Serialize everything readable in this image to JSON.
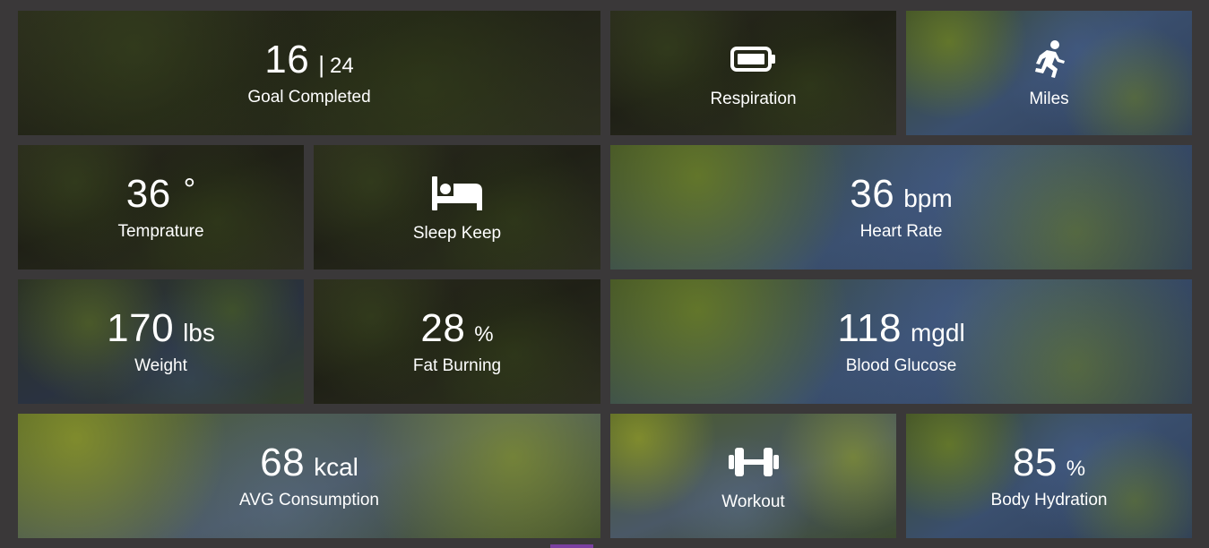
{
  "tiles": {
    "goal": {
      "value": "16",
      "total": "24",
      "separator": "|",
      "label": "Goal Completed"
    },
    "respiration": {
      "icon": "battery-icon",
      "label": "Respiration"
    },
    "miles": {
      "icon": "running-person-icon",
      "label": "Miles"
    },
    "temperature": {
      "value": "36",
      "unit": "°",
      "label": "Temprature"
    },
    "sleep": {
      "icon": "bed-icon",
      "label": "Sleep Keep"
    },
    "heart_rate": {
      "value": "36",
      "unit": "bpm",
      "label": "Heart Rate"
    },
    "weight": {
      "value": "170",
      "unit": "lbs",
      "label": "Weight"
    },
    "fat_burning": {
      "value": "28",
      "unit": "%",
      "label": "Fat Burning"
    },
    "blood_glucose": {
      "value": "118",
      "unit": "mgdl",
      "label": "Blood Glucose"
    },
    "avg_consumption": {
      "value": "68",
      "unit": "kcal",
      "label": "AVG Consumption"
    },
    "workout": {
      "icon": "dumbbell-icon",
      "label": "Workout"
    },
    "body_hydration": {
      "value": "85",
      "unit": "%",
      "label": "Body Hydration"
    }
  },
  "colors": {
    "background": "#3a3839",
    "text": "#ffffff",
    "accent": "#7a3fa0"
  }
}
